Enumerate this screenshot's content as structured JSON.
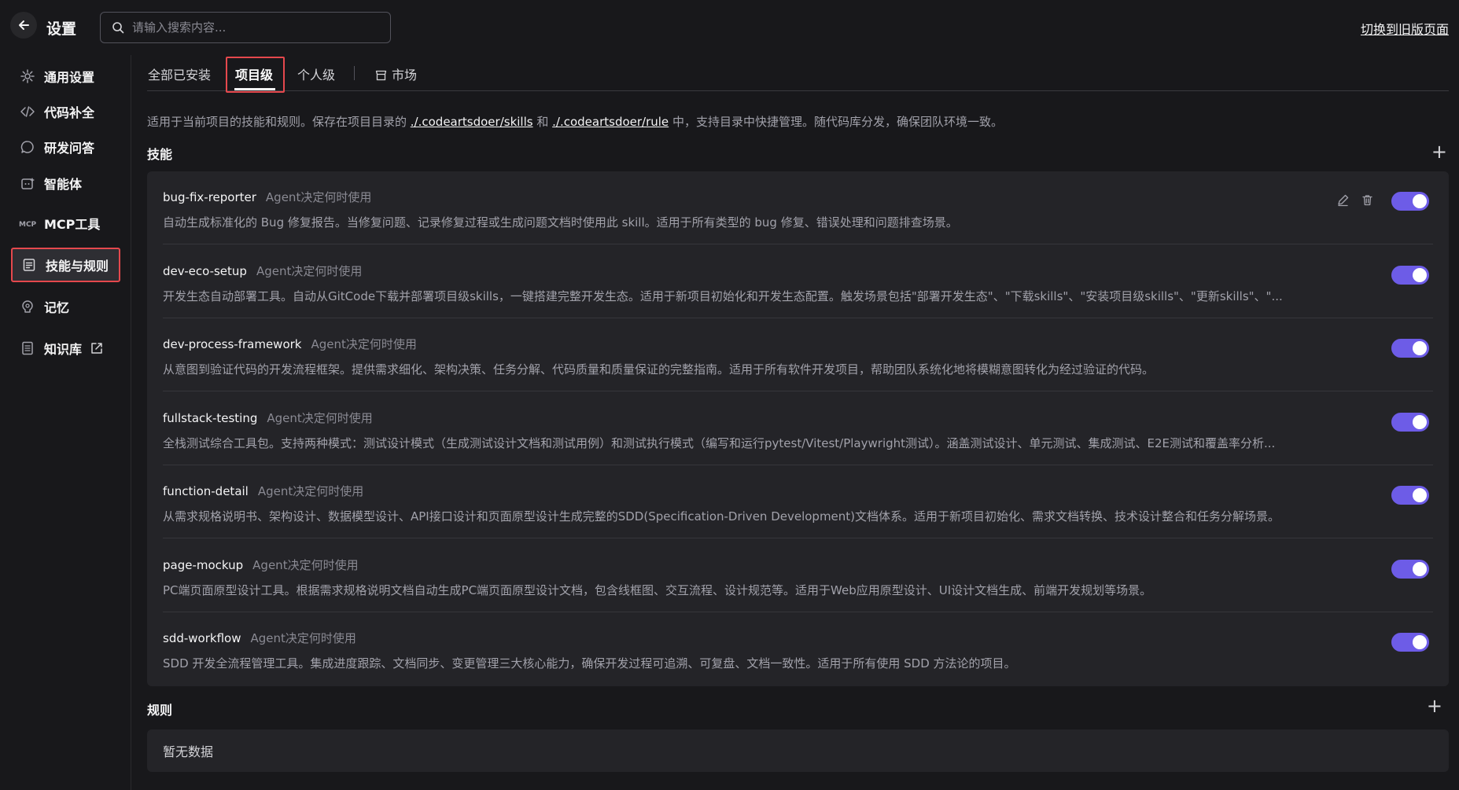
{
  "header": {
    "title": "设置",
    "search_placeholder": "请输入搜索内容...",
    "switch_old_label": "切换到旧版页面"
  },
  "sidebar": {
    "items": [
      {
        "label": "通用设置",
        "icon": "gear-icon"
      },
      {
        "label": "代码补全",
        "icon": "code-icon"
      },
      {
        "label": "研发问答",
        "icon": "chat-icon"
      },
      {
        "label": "智能体",
        "icon": "agent-icon"
      },
      {
        "label": "MCP工具",
        "icon": "mcp-icon"
      },
      {
        "label": "技能与规则",
        "icon": "rules-icon",
        "active": true
      },
      {
        "label": "记忆",
        "icon": "memory-icon"
      },
      {
        "label": "知识库",
        "icon": "book-icon",
        "external": true
      }
    ]
  },
  "tabs": [
    {
      "label": "全部已安装"
    },
    {
      "label": "项目级",
      "active": true
    },
    {
      "label": "个人级"
    },
    {
      "label": "市场",
      "icon": "store-icon"
    }
  ],
  "description": {
    "prefix": "适用于当前项目的技能和规则。保存在项目目录的 ",
    "link1": "./.codeartsdoer/skills",
    "middle": " 和 ",
    "link2": "./.codeartsdoer/rule",
    "suffix": " 中，支持目录中快捷管理。随代码库分发，确保团队环境一致。"
  },
  "skills_section": {
    "title": "技能",
    "add_label": "+",
    "items": [
      {
        "name": "bug-fix-reporter",
        "mode": "Agent决定何时使用",
        "desc": "自动生成标准化的 Bug 修复报告。当修复问题、记录修复过程或生成问题文档时使用此 skill。适用于所有类型的 bug 修复、错误处理和问题排查场景。",
        "enabled": true,
        "show_actions": true
      },
      {
        "name": "dev-eco-setup",
        "mode": "Agent决定何时使用",
        "desc": "开发生态自动部署工具。自动从GitCode下载并部署项目级skills，一键搭建完整开发生态。适用于新项目初始化和开发生态配置。触发场景包括\"部署开发生态\"、\"下载skills\"、\"安装项目级skills\"、\"更新skills\"、\"...",
        "enabled": true
      },
      {
        "name": "dev-process-framework",
        "mode": "Agent决定何时使用",
        "desc": "从意图到验证代码的开发流程框架。提供需求细化、架构决策、任务分解、代码质量和质量保证的完整指南。适用于所有软件开发项目，帮助团队系统化地将模糊意图转化为经过验证的代码。",
        "enabled": true
      },
      {
        "name": "fullstack-testing",
        "mode": "Agent决定何时使用",
        "desc": "全栈测试综合工具包。支持两种模式：测试设计模式（生成测试设计文档和测试用例）和测试执行模式（编写和运行pytest/Vitest/Playwright测试）。涵盖测试设计、单元测试、集成测试、E2E测试和覆盖率分析...",
        "enabled": true
      },
      {
        "name": "function-detail",
        "mode": "Agent决定何时使用",
        "desc": "从需求规格说明书、架构设计、数据模型设计、API接口设计和页面原型设计生成完整的SDD(Specification-Driven Development)文档体系。适用于新项目初始化、需求文档转换、技术设计整合和任务分解场景。",
        "enabled": true
      },
      {
        "name": "page-mockup",
        "mode": "Agent决定何时使用",
        "desc": "PC端页面原型设计工具。根据需求规格说明文档自动生成PC端页面原型设计文档，包含线框图、交互流程、设计规范等。适用于Web应用原型设计、UI设计文档生成、前端开发规划等场景。",
        "enabled": true
      },
      {
        "name": "sdd-workflow",
        "mode": "Agent决定何时使用",
        "desc": "SDD 开发全流程管理工具。集成进度跟踪、文档同步、变更管理三大核心能力，确保开发过程可追溯、可复盘、文档一致性。适用于所有使用 SDD 方法论的项目。",
        "enabled": true
      }
    ]
  },
  "rules_section": {
    "title": "规则",
    "add_label": "+",
    "empty_text": "暂无数据"
  },
  "colors": {
    "background": "#18181b",
    "panel": "#242428",
    "toggle_on": "#6d5ce7",
    "highlight_border": "#e5484d"
  }
}
